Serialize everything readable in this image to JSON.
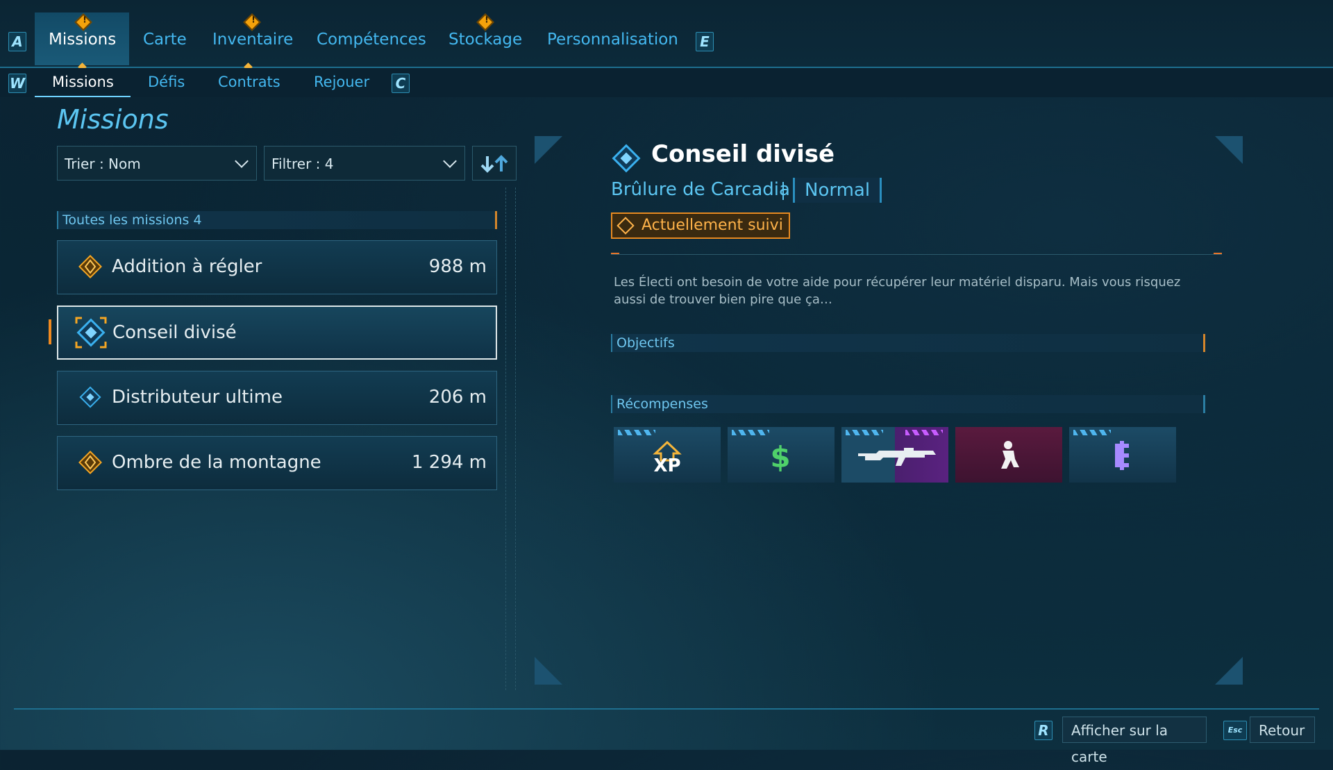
{
  "nav": {
    "key_left": "A",
    "key_right": "E",
    "tabs": [
      {
        "label": "Missions",
        "alert": true,
        "active": true
      },
      {
        "label": "Carte",
        "alert": false,
        "active": false
      },
      {
        "label": "Inventaire",
        "alert": true,
        "active": false
      },
      {
        "label": "Compétences",
        "alert": false,
        "active": false
      },
      {
        "label": "Stockage",
        "alert": true,
        "active": false
      },
      {
        "label": "Personnalisation",
        "alert": false,
        "active": false
      }
    ]
  },
  "subnav": {
    "key_left": "W",
    "key_right": "C",
    "tabs": [
      {
        "label": "Missions",
        "active": true
      },
      {
        "label": "Défis",
        "active": false
      },
      {
        "label": "Contrats",
        "active": false
      },
      {
        "label": "Rejouer",
        "active": false
      }
    ]
  },
  "page_title": "Missions",
  "controls": {
    "sort_label": "Trier : Nom",
    "filter_label": "Filtrer : 4"
  },
  "list": {
    "header": "Toutes les missions 4",
    "missions": [
      {
        "name": "Addition à régler",
        "distance": "988 m",
        "icon": "gold-diamond-icon",
        "selected": false
      },
      {
        "name": "Conseil divisé",
        "distance": "",
        "icon": "blue-diamond-icon",
        "selected": true
      },
      {
        "name": "Distributeur ultime",
        "distance": "206 m",
        "icon": "blue-diamond-icon",
        "selected": false
      },
      {
        "name": "Ombre de la montagne",
        "distance": "1 294 m",
        "icon": "gold-diamond-icon",
        "selected": false
      }
    ]
  },
  "detail": {
    "title": "Conseil divisé",
    "subtitle": "Brûlure de Carcadia",
    "difficulty": "Normal",
    "tracked_label": "Actuellement suivi",
    "description": "Les Électi ont besoin de votre aide pour récupérer leur matériel disparu. Mais vous risquez aussi de trouver bien pire que ça…",
    "objectives_label": "Objectifs",
    "rewards_label": "Récompenses",
    "rewards": [
      {
        "icon": "xp-icon",
        "text": "XP",
        "color": "#ffffff"
      },
      {
        "icon": "money-icon",
        "text": "$",
        "color": "#4fd06a"
      },
      {
        "icon": "weapon-icon",
        "text": "",
        "color": "#ffffff"
      },
      {
        "icon": "cosmetic-emote-icon",
        "text": "",
        "color": "#ffffff"
      },
      {
        "icon": "eridium-icon",
        "text": "",
        "color": "#a78aff"
      }
    ]
  },
  "footer": {
    "map_key": "R",
    "map_label": "Afficher sur la carte",
    "back_key": "Esc",
    "back_label": "Retour"
  }
}
